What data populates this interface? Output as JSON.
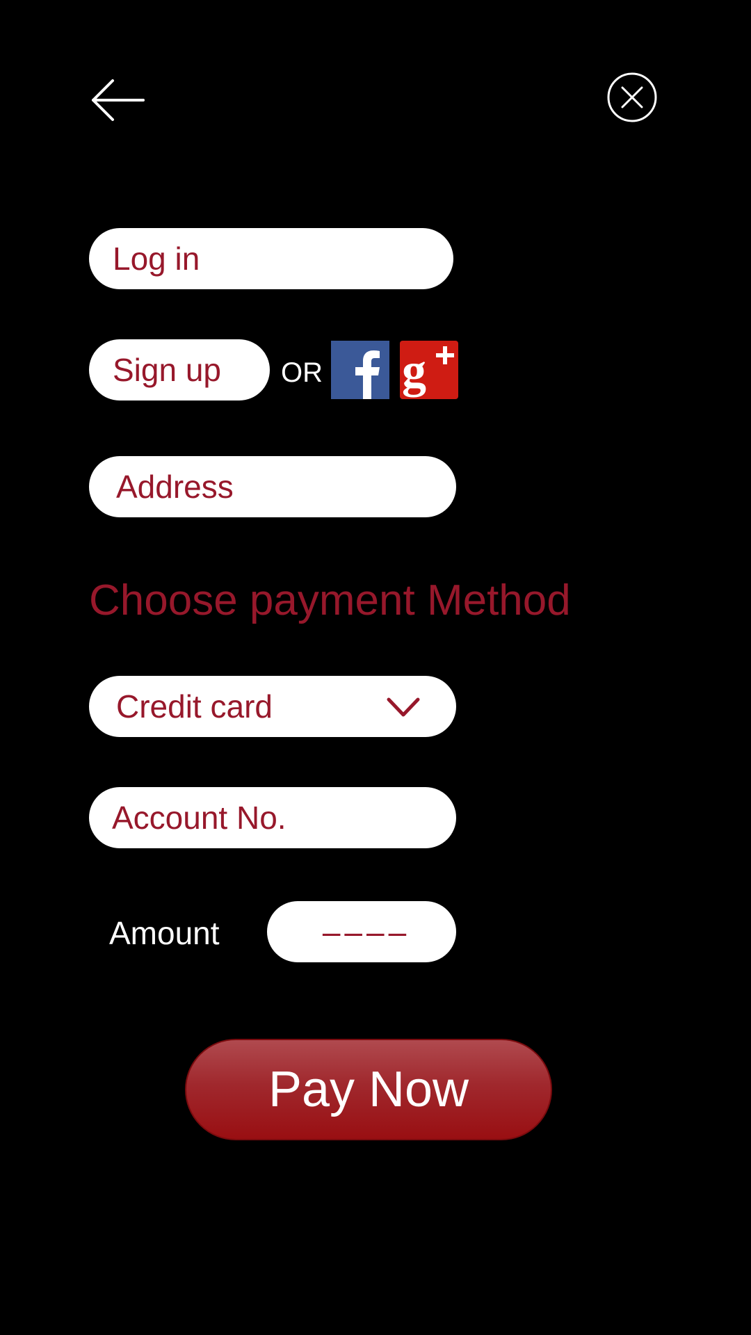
{
  "header": {
    "back_icon": "arrow-left-icon",
    "close_icon": "close-circle-icon"
  },
  "auth": {
    "login_label": "Log in",
    "signup_label": "Sign up",
    "or_label": "OR",
    "facebook_icon": "facebook-icon",
    "google_plus_icon": "google-plus-icon"
  },
  "form": {
    "address_placeholder": "Address",
    "payment_title": "Choose payment Method",
    "payment_method": {
      "selected": "Credit card",
      "icon": "chevron-down-icon"
    },
    "account_placeholder": "Account No.",
    "amount_label": "Amount",
    "amount_value": "––––"
  },
  "actions": {
    "pay_label": "Pay Now"
  },
  "colors": {
    "background": "#000000",
    "accent": "#97182b",
    "button_red": "#a0282d",
    "facebook_blue": "#3b5998",
    "google_red": "#cf1c13"
  }
}
